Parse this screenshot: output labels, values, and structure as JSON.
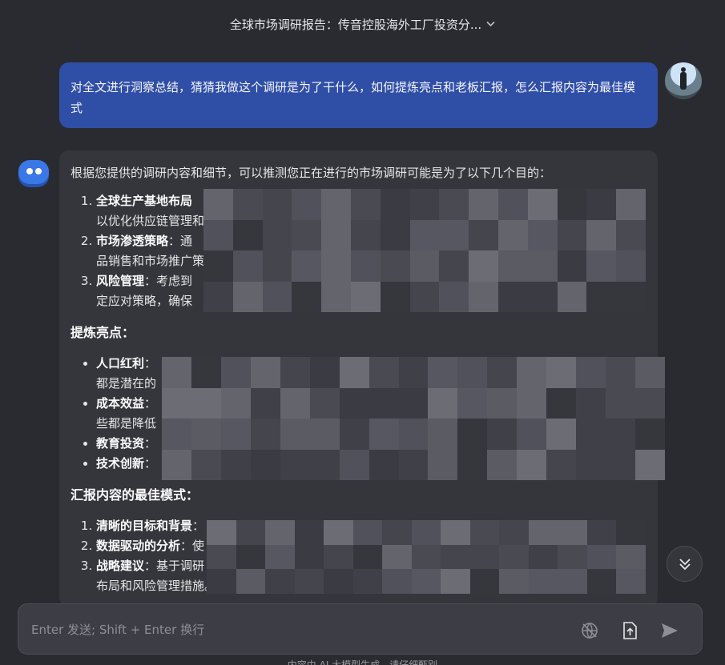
{
  "header": {
    "title": "全球市场调研报告：传音控股海外工厂投资分...",
    "chevron_icon": "chevron-down-icon"
  },
  "user_message": {
    "text": "对全文进行洞察总结，猜猜我做这个调研是为了干什么，如何提炼亮点和老板汇报，怎么汇报内容为最佳模式",
    "avatar": "user-avatar"
  },
  "bot_message": {
    "intro": "根据您提供的调研内容和细节，可以推测您正在进行的市场调研可能是为了以下几个目的：",
    "purposes": [
      {
        "bold": "全球生产基地布局",
        "text": "",
        "cont": "以优化供应链管理和"
      },
      {
        "bold": "市场渗透策略",
        "text": "：通",
        "cont": "品销售和市场推广策"
      },
      {
        "bold": "风险管理",
        "text": "：考虑到",
        "cont": "定应对策略，确保"
      }
    ],
    "highlights_heading": "提炼亮点：",
    "highlights": [
      {
        "bold": "人口红利",
        "text": "：",
        "cont": "都是潜在的"
      },
      {
        "bold": "成本效益",
        "text": "：",
        "cont": "些都是降低"
      },
      {
        "bold": "教育投资",
        "text": "：",
        "cont": ""
      },
      {
        "bold": "技术创新",
        "text": "：",
        "cont": ""
      }
    ],
    "report_heading": "汇报内容的最佳模式：",
    "report_items": [
      {
        "bold": "清晰的目标和背景",
        "text": "：",
        "cont": ""
      },
      {
        "bold": "数据驱动的分析",
        "text": "：使",
        "cont": ""
      },
      {
        "bold": "战略建议",
        "text": "：基于调研",
        "cont": "布局和风险管理措施。"
      }
    ]
  },
  "scroll_button": {
    "icon": "double-chevron-down-icon"
  },
  "input": {
    "placeholder": "Enter 发送; Shift + Enter 换行"
  },
  "footer": {
    "note": "内容由 AI 大模型生成，请仔细甄别"
  },
  "colors": {
    "background": "#2a2b31",
    "user_bubble": "#2f4ea6",
    "bot_bubble": "#35363c",
    "accent": "#3a78e8"
  }
}
